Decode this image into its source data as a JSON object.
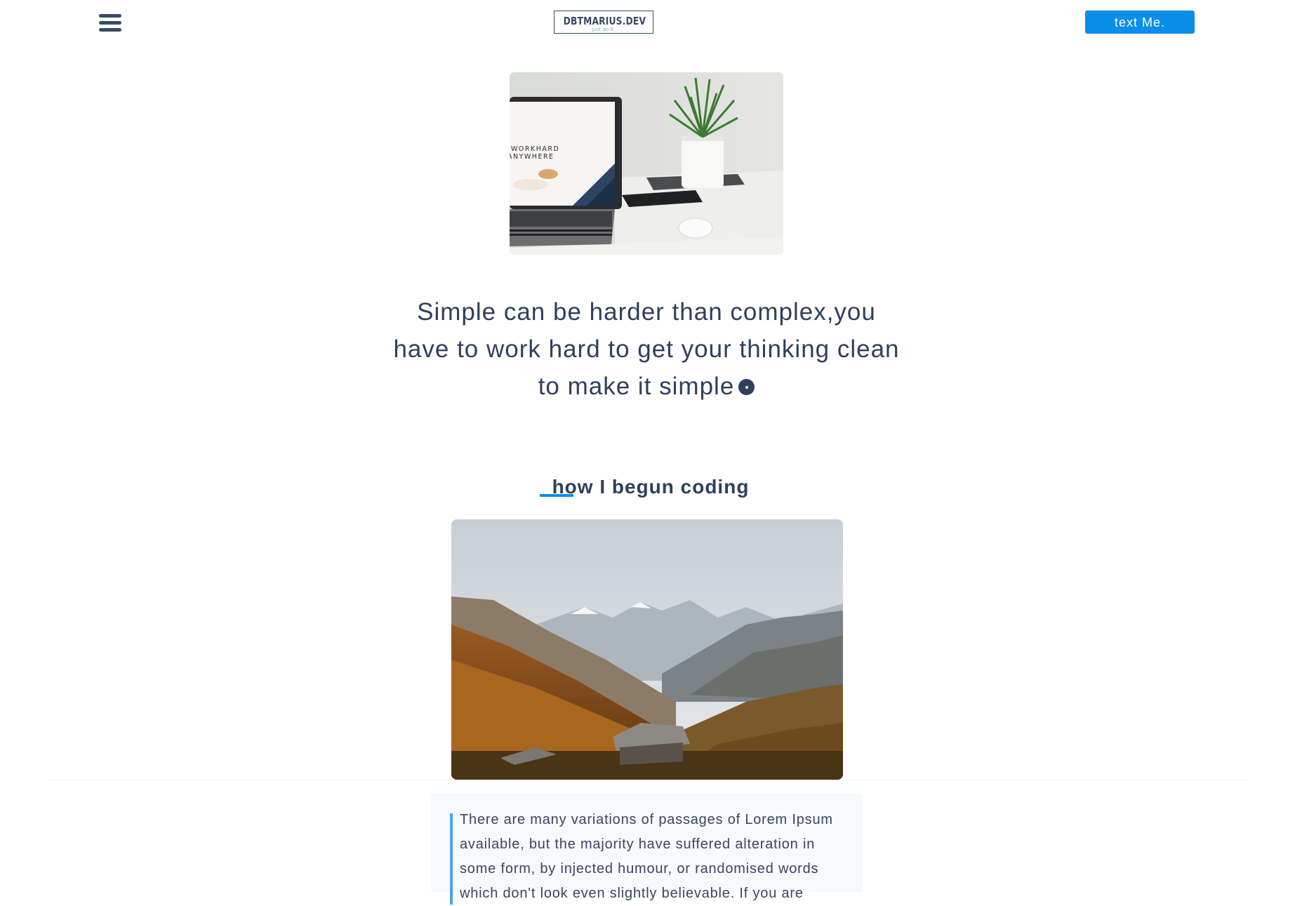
{
  "header": {
    "menu_icon": "hamburger-menu-icon",
    "logo_text": "DBTMARIUS.DEV",
    "logo_subtext": "just do it.",
    "cta_label": "text Me."
  },
  "hero": {
    "image_description": "laptop-and-plant-photo",
    "screen_text_line1": "WORKHARD",
    "screen_text_line2": "ANYWHERE"
  },
  "quote": {
    "text": "Simple can be harder than complex,you have to work hard to get your thinking clean to make it simple"
  },
  "section": {
    "title": "how I begun coding"
  },
  "body": {
    "paragraph": "There are many variations of passages of Lorem Ipsum available, but the majority have suffered alteration in some form, by injected humour, or randomised words which don't look even slightly believable. If you are"
  },
  "colors": {
    "accent": "#0a8ee8",
    "text": "#2f3f5c",
    "quote_bar": "#4aa3f0"
  }
}
